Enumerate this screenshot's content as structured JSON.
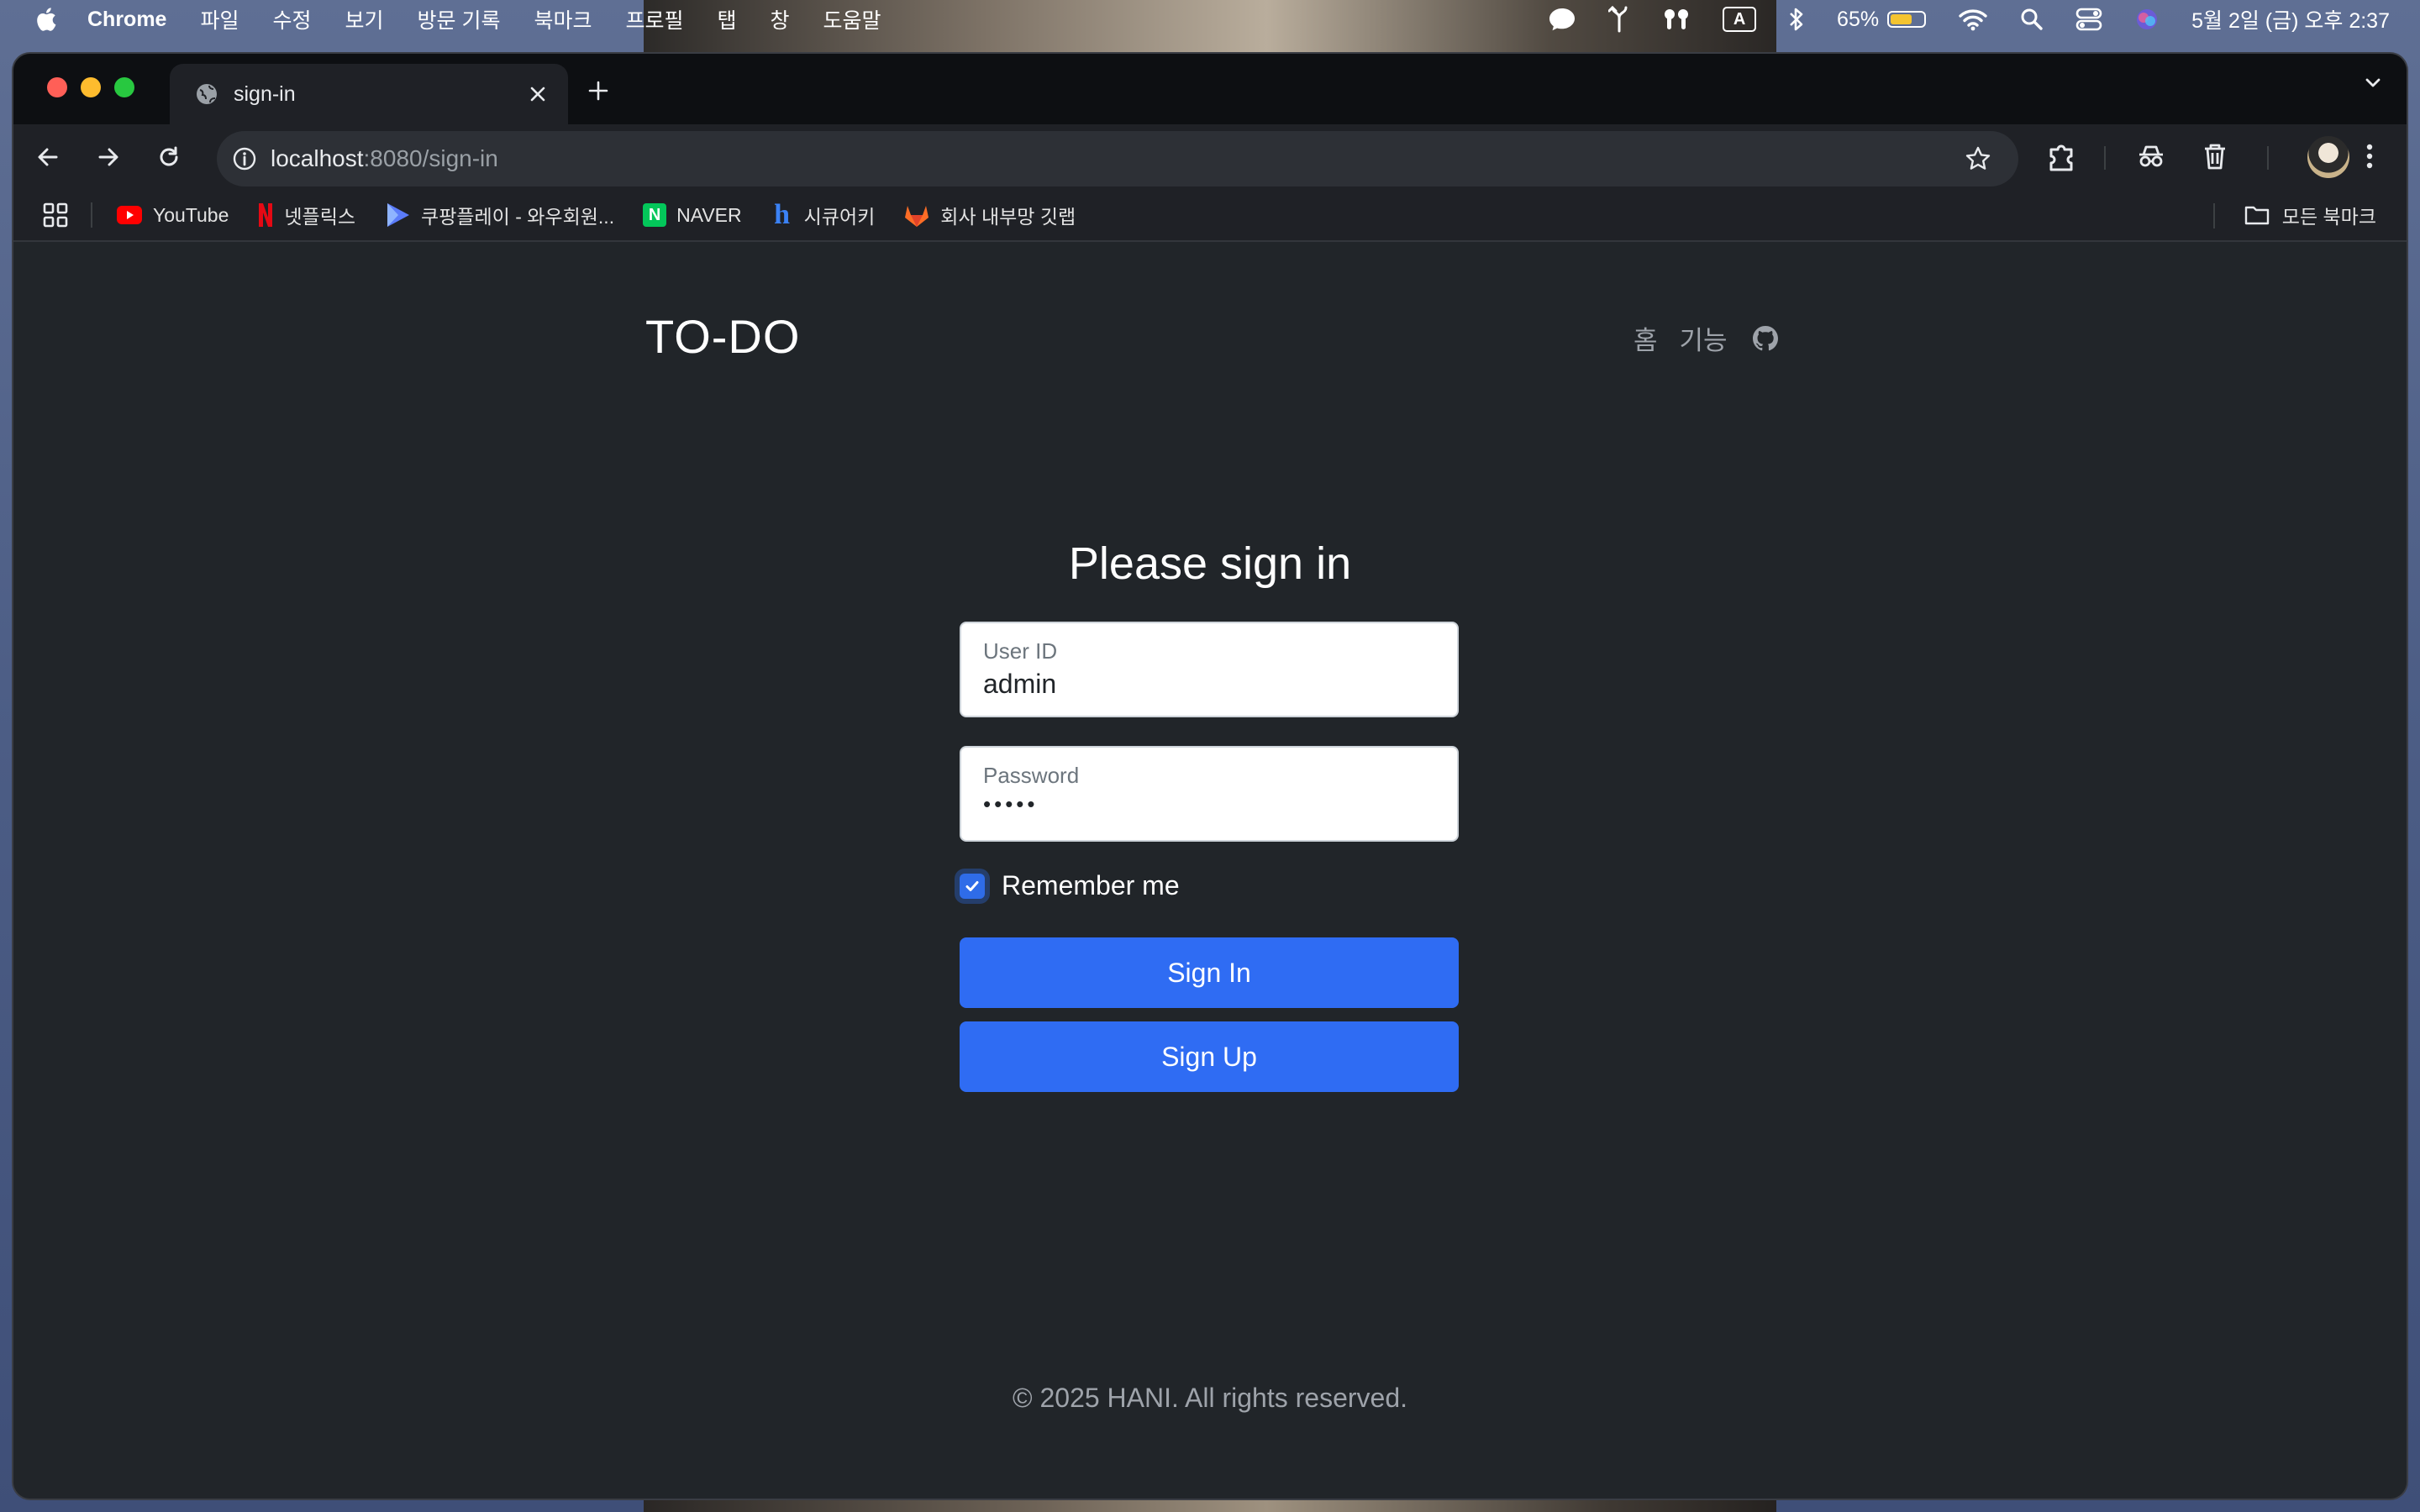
{
  "menubar": {
    "app_name": "Chrome",
    "items": [
      "파일",
      "수정",
      "보기",
      "방문 기록",
      "북마크",
      "프로필",
      "탭",
      "창",
      "도움말"
    ],
    "battery_percent": "65%",
    "battery_level": 0.65,
    "input_indicator": "A",
    "datetime": "5월 2일 (금) 오후 2:37",
    "status_icons": [
      "messages-icon",
      "fork-icon",
      "airpods-icon",
      "input-source-icon",
      "bluetooth-icon",
      "battery-icon",
      "wifi-icon",
      "spotlight-icon",
      "control-center-icon",
      "siri-icon"
    ]
  },
  "browser": {
    "tab_title": "sign-in",
    "url_host": "localhost",
    "url_rest": ":8080/sign-in",
    "bookmarks": [
      {
        "label": "YouTube",
        "icon": "youtube-icon",
        "color": "#ff0000"
      },
      {
        "label": "넷플릭스",
        "icon": "netflix-icon",
        "color": "#e50914"
      },
      {
        "label": "쿠팡플레이 - 와우회원...",
        "icon": "coupang-play-icon",
        "color": "#5b7cfa"
      },
      {
        "label": "NAVER",
        "icon": "naver-icon",
        "color": "#03c75a"
      },
      {
        "label": "시큐어키",
        "icon": "securekey-icon",
        "color": "#3b82f6"
      },
      {
        "label": "회사 내부망 깃랩",
        "icon": "gitlab-icon",
        "color": "#fc6d26"
      }
    ],
    "all_bookmarks_label": "모든 북마크"
  },
  "page": {
    "brand": "TO-DO",
    "nav": {
      "home": "홈",
      "features": "기능"
    },
    "heading": "Please sign in",
    "user_id": {
      "label": "User ID",
      "value": "admin"
    },
    "password": {
      "label": "Password",
      "masked": "•••••"
    },
    "remember_me": {
      "label": "Remember me",
      "checked": true
    },
    "sign_in_label": "Sign In",
    "sign_up_label": "Sign Up",
    "footer": "© 2025 HANI. All rights reserved."
  },
  "colors": {
    "page_bg": "#212529",
    "primary": "#2f6cf3",
    "muted_text": "#9ea3aa"
  }
}
